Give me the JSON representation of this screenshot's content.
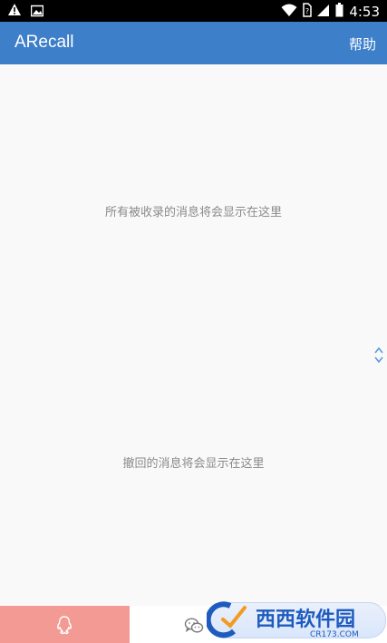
{
  "status_bar": {
    "time": "4:53",
    "icons": [
      "warning-icon",
      "image-icon",
      "wifi-icon",
      "no-sim-icon",
      "signal-icon",
      "battery-icon"
    ]
  },
  "app_bar": {
    "title": "ARecall",
    "help_label": "帮助",
    "color": "#3d7fc9"
  },
  "content": {
    "collected_message": "所有被收录的消息将会显示在这里",
    "recalled_message": "撤回的消息将会显示在这里",
    "toggle_icon": "chevron-up-down-icon"
  },
  "bottom_nav": {
    "tabs": [
      {
        "icon": "qq-icon",
        "active": true,
        "color": "#f39a95"
      },
      {
        "icon": "wechat-icon",
        "active": false
      }
    ]
  },
  "watermark": {
    "brand_text": "西西软件园",
    "domain_text": "CR173.COM"
  }
}
